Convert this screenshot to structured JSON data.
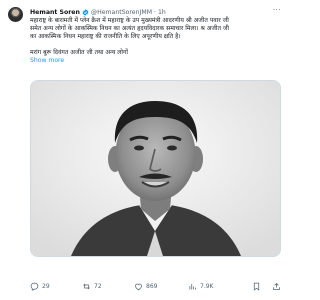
{
  "tweet": {
    "name": "Hemant Soren",
    "handle": "@HemantSorenJMM",
    "time": "1h",
    "text_line1": "महाराष्ट्र के बारामती में प्लेन क्रैश में महाराष्ट्र के उप मुख्यमंत्री आदरणीय श्री अजीत पवार जी",
    "text_line2": "समेत अन्य लोगों के आकस्मिक निधन का अत्यंत हृदयविदारक समाचार मिला। श्र अजीत जी",
    "text_line3": "का आकस्मिक निधन महाराष्ट्र की राजनीति के लिए अपूरणीय क्षति है।",
    "text_line4": "मरांग बुरू दिवंगत अजीत जी तथा अन्य लोगों",
    "show_more": "Show more"
  },
  "actions": {
    "replies": "29",
    "reposts": "72",
    "likes": "869",
    "views": "7.9K"
  },
  "colors": {
    "accent": "#1d9bf0",
    "muted": "#536471",
    "text": "#0f1419"
  },
  "icons": [
    "avatar",
    "verified-badge-icon",
    "more-icon",
    "reply-icon",
    "repost-icon",
    "like-icon",
    "views-icon",
    "bookmark-icon",
    "share-icon"
  ]
}
